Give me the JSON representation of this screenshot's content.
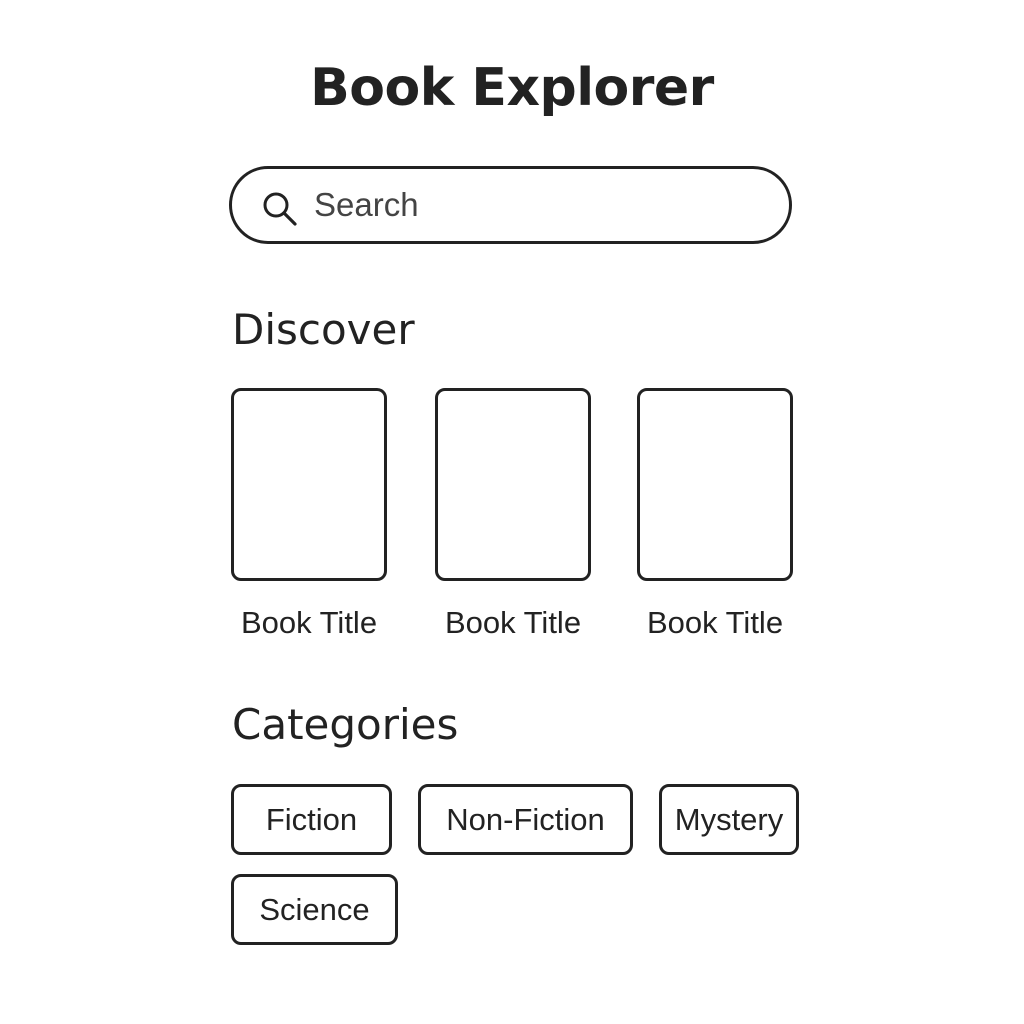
{
  "app": {
    "title": "Book Explorer"
  },
  "search": {
    "placeholder": "Search",
    "icon": "search-icon"
  },
  "discover": {
    "heading": "Discover",
    "books": [
      {
        "title": "Book Title"
      },
      {
        "title": "Book Title"
      },
      {
        "title": "Book Title"
      }
    ]
  },
  "categories": {
    "heading": "Categories",
    "items": [
      {
        "label": "Fiction"
      },
      {
        "label": "Non-Fiction"
      },
      {
        "label": "Mystery"
      },
      {
        "label": "Science"
      }
    ]
  },
  "colors": {
    "background": "#ffffff",
    "text": "#222222",
    "border": "#222222"
  }
}
